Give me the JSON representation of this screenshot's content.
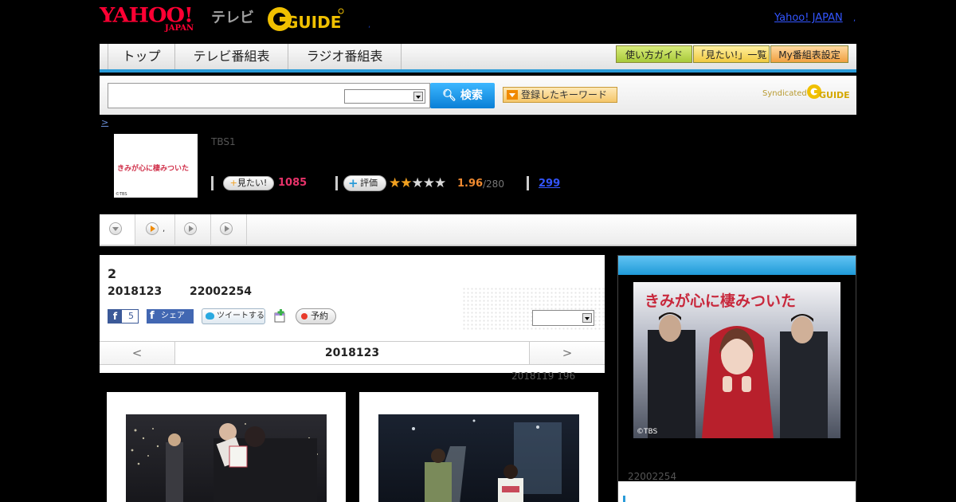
{
  "header": {
    "yahoo_logo": "YAHOO!",
    "yahoo_logo_sub": "JAPAN",
    "tv_label": "テレビ",
    "gguide_logo": "GUIDE",
    "yahoo_japan_link": "Yahoo! JAPAN"
  },
  "nav": {
    "tabs": [
      "トップ",
      "テレビ番組表",
      "ラジオ番組表"
    ],
    "buttons": [
      "使い方ガイド",
      "「見たい!」一覧",
      "My番組表設定"
    ]
  },
  "search": {
    "placeholder": "",
    "select_value": "",
    "button_label": "検索",
    "keyword_button": "登録したキーワード",
    "syndicated": "Syndicated"
  },
  "breadcrumb": ">",
  "program": {
    "thumb_text": "きみが心に棲みついた",
    "thumb_copyright": "©TBS",
    "channel": "TBS1",
    "mitai_label": "見たい!",
    "mitai_count": "1085",
    "hyoka_label": "評価",
    "rating": 1.96,
    "score": "1.96",
    "score_total": "/280",
    "review_count": "299"
  },
  "tabs_strip": {
    "tab2_dot": ","
  },
  "episode": {
    "title": "2",
    "date": "2018123",
    "time": "22002254",
    "fb_like_count": "5",
    "fb_share": "シェア",
    "tweet": "ツイートする",
    "yoyaku": "予約",
    "select_value": "",
    "pager_prev": "<",
    "pager_current": "2018123",
    "pager_next": ">",
    "updated": "2018119  196"
  },
  "side": {
    "poster_title": "きみが心に棲みついた",
    "poster_copyright": "©TBS",
    "time": "22002254"
  },
  "colors": {
    "accent_blue": "#2a9bd8",
    "mitai_pink": "#e8336a",
    "score_orange": "#f08a30",
    "link_blue": "#3355ff"
  }
}
